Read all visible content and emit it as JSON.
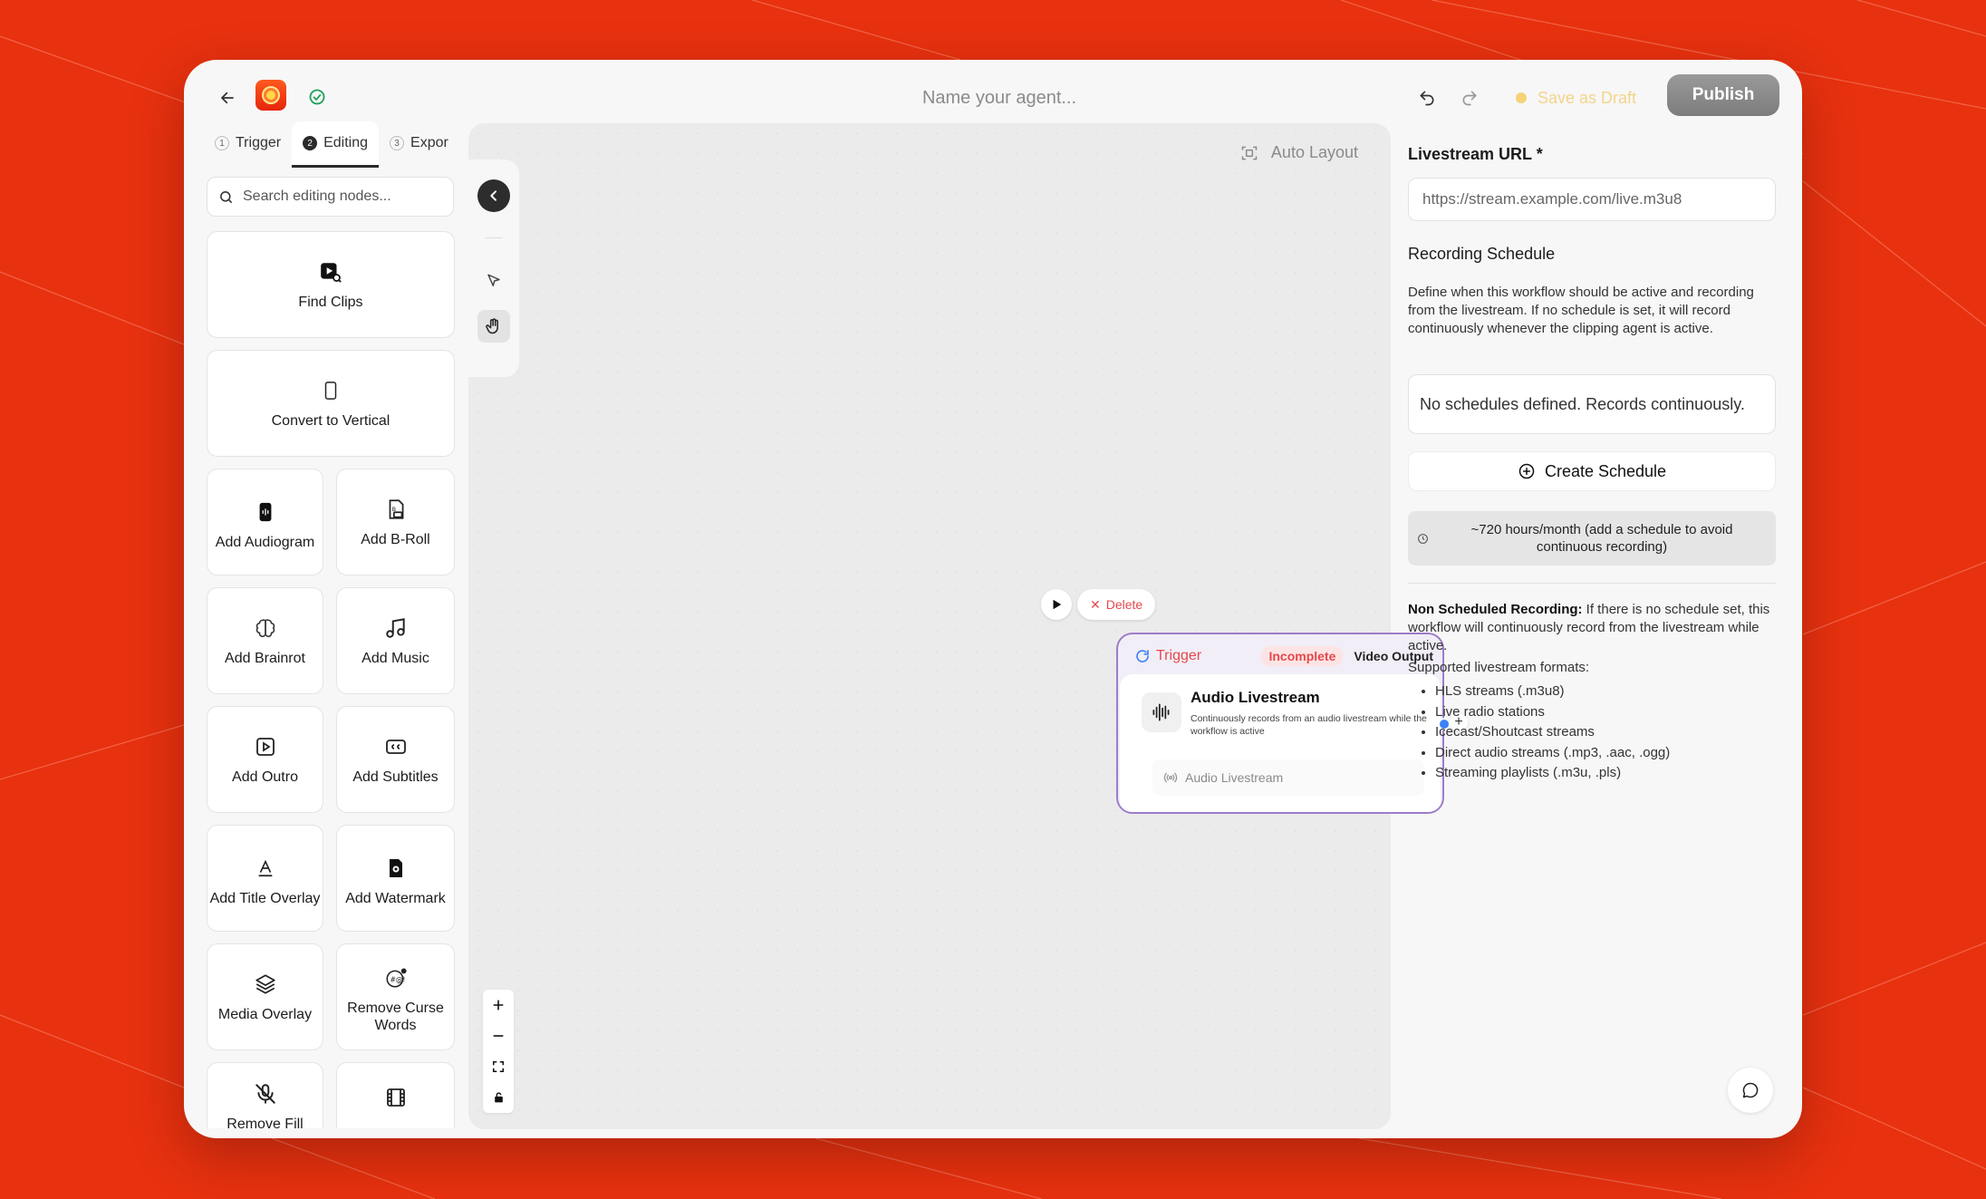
{
  "header": {
    "agent_name_placeholder": "Name your agent...",
    "save_draft_label": "Save as Draft",
    "publish_label": "Publish"
  },
  "left_panel": {
    "tabs": [
      {
        "num": "1",
        "label": "Trigger"
      },
      {
        "num": "2",
        "label": "Editing",
        "active": true
      },
      {
        "num": "3",
        "label": "Expor"
      }
    ],
    "search_placeholder": "Search editing nodes...",
    "nodes": [
      {
        "label": "Find Clips",
        "icon": "find-clips-icon"
      },
      {
        "label": "Convert to Vertical",
        "icon": "phone-vertical-icon"
      },
      {
        "label": "Add Audiogram",
        "icon": "audiogram-icon"
      },
      {
        "label": "Add B-Roll",
        "icon": "broll-icon"
      },
      {
        "label": "Add Brainrot",
        "icon": "brain-icon"
      },
      {
        "label": "Add Music",
        "icon": "music-note-icon"
      },
      {
        "label": "Add Outro",
        "icon": "outro-play-icon"
      },
      {
        "label": "Add Subtitles",
        "icon": "subtitles-icon"
      },
      {
        "label": "Add Title Overlay",
        "icon": "title-overlay-icon"
      },
      {
        "label": "Add Watermark",
        "icon": "watermark-icon"
      },
      {
        "label": "Media Overlay",
        "icon": "layers-icon"
      },
      {
        "label": "Remove Curse Words",
        "icon": "curse-words-icon"
      },
      {
        "label": "Remove Fill",
        "icon": "mic-off-icon"
      },
      {
        "label": "",
        "icon": "film-icon"
      }
    ]
  },
  "canvas": {
    "auto_layout_label": "Auto Layout",
    "delete_label": "Delete",
    "flow_node": {
      "header_label": "Trigger",
      "status_badge": "Incomplete",
      "output_label": "Video Output",
      "title": "Audio Livestream",
      "description": "Continuously records from an audio livestream while the workflow is active",
      "field_label": "Audio Livestream"
    }
  },
  "right_panel": {
    "url_label": "Livestream URL *",
    "url_value": "https://stream.example.com/live.m3u8",
    "schedule_heading": "Recording Schedule",
    "schedule_description": "Define when this workflow should be active and recording from the livestream. If no schedule is set, it will record continuously whenever the clipping agent is active.",
    "no_schedules_text": "No schedules defined. Records continuously.",
    "create_schedule_label": "Create Schedule",
    "hours_text": "~720 hours/month (add a schedule to avoid continuous recording)",
    "non_scheduled_title": "Non Scheduled Recording:",
    "non_scheduled_text": " If there is no schedule set, this workflow will continuously record from the livestream while active.",
    "formats_heading": "Supported livestream formats:",
    "formats": [
      "HLS streams (.m3u8)",
      "Live radio stations",
      "Icecast/Shoutcast streams",
      "Direct audio streams (.mp3, .aac, .ogg)",
      "Streaming playlists (.m3u, .pls)"
    ]
  },
  "colors": {
    "background": "#e8310f",
    "accent_red": "#e5484d",
    "node_border": "#9d7cc9",
    "handle_blue": "#3b82f6"
  }
}
